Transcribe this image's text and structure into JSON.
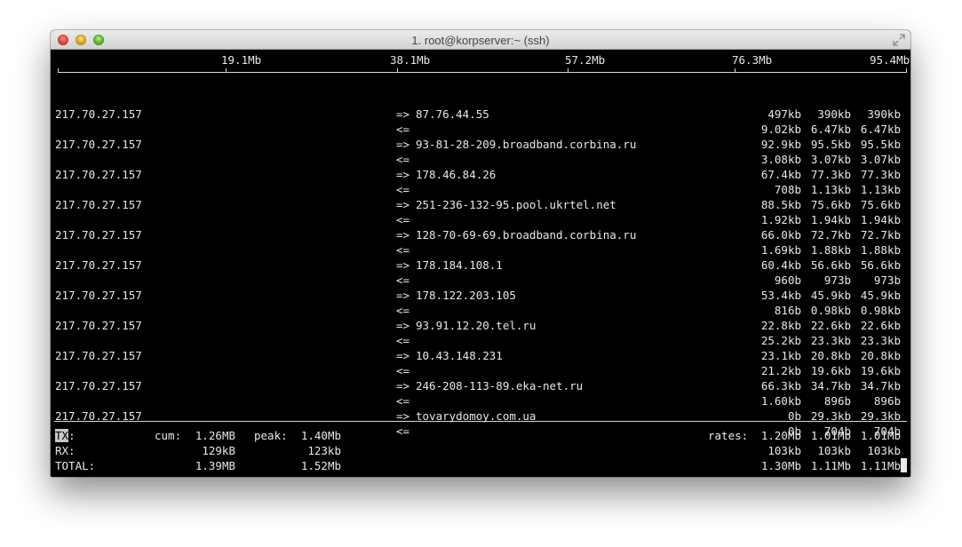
{
  "window": {
    "title": "1. root@korpserver:~ (ssh)"
  },
  "scale": [
    "19.1Mb",
    "38.1Mb",
    "57.2Mb",
    "76.3Mb",
    "95.4Mb"
  ],
  "connections": [
    {
      "src": "217.70.27.157",
      "dst": "87.76.44.55",
      "out": [
        "497kb",
        "390kb",
        "390kb"
      ],
      "in": [
        "9.02kb",
        "6.47kb",
        "6.47kb"
      ]
    },
    {
      "src": "217.70.27.157",
      "dst": "93-81-28-209.broadband.corbina.ru",
      "out": [
        "92.9kb",
        "95.5kb",
        "95.5kb"
      ],
      "in": [
        "3.08kb",
        "3.07kb",
        "3.07kb"
      ]
    },
    {
      "src": "217.70.27.157",
      "dst": "178.46.84.26",
      "out": [
        "67.4kb",
        "77.3kb",
        "77.3kb"
      ],
      "in": [
        "708b",
        "1.13kb",
        "1.13kb"
      ]
    },
    {
      "src": "217.70.27.157",
      "dst": "251-236-132-95.pool.ukrtel.net",
      "out": [
        "88.5kb",
        "75.6kb",
        "75.6kb"
      ],
      "in": [
        "1.92kb",
        "1.94kb",
        "1.94kb"
      ]
    },
    {
      "src": "217.70.27.157",
      "dst": "128-70-69-69.broadband.corbina.ru",
      "out": [
        "66.0kb",
        "72.7kb",
        "72.7kb"
      ],
      "in": [
        "1.69kb",
        "1.88kb",
        "1.88kb"
      ]
    },
    {
      "src": "217.70.27.157",
      "dst": "178.184.108.1",
      "out": [
        "60.4kb",
        "56.6kb",
        "56.6kb"
      ],
      "in": [
        "960b",
        "973b",
        "973b"
      ]
    },
    {
      "src": "217.70.27.157",
      "dst": "178.122.203.105",
      "out": [
        "53.4kb",
        "45.9kb",
        "45.9kb"
      ],
      "in": [
        "816b",
        "0.98kb",
        "0.98kb"
      ]
    },
    {
      "src": "217.70.27.157",
      "dst": "93.91.12.20.tel.ru",
      "out": [
        "22.8kb",
        "22.6kb",
        "22.6kb"
      ],
      "in": [
        "25.2kb",
        "23.3kb",
        "23.3kb"
      ]
    },
    {
      "src": "217.70.27.157",
      "dst": "10.43.148.231",
      "out": [
        "23.1kb",
        "20.8kb",
        "20.8kb"
      ],
      "in": [
        "21.2kb",
        "19.6kb",
        "19.6kb"
      ]
    },
    {
      "src": "217.70.27.157",
      "dst": "246-208-113-89.eka-net.ru",
      "out": [
        "66.3kb",
        "34.7kb",
        "34.7kb"
      ],
      "in": [
        "1.60kb",
        "896b",
        "896b"
      ]
    },
    {
      "src": "217.70.27.157",
      "dst": "tovarydomoy.com.ua",
      "out": [
        "0b",
        "29.3kb",
        "29.3kb"
      ],
      "in": [
        "0b",
        "704b",
        "704b"
      ]
    }
  ],
  "arrows": {
    "out": "=>",
    "in": "<="
  },
  "totals": {
    "tx_prefix": "TX",
    "tx_suffix": ":",
    "rx_label": "RX:",
    "total_label": "TOTAL:",
    "cum_label": "cum:",
    "peak_label": "peak:",
    "rates_label": "rates:",
    "tx": {
      "cum": "1.26MB",
      "peak": "1.40Mb",
      "rates": [
        "1.20Mb",
        "1.01Mb",
        "1.01Mb"
      ]
    },
    "rx": {
      "cum": "129kB",
      "peak": "123kb",
      "rates": [
        "103kb",
        "103kb",
        "103kb"
      ]
    },
    "total": {
      "cum": "1.39MB",
      "peak": "1.52Mb",
      "rates": [
        "1.30Mb",
        "1.11Mb",
        "1.11Mb"
      ]
    }
  }
}
